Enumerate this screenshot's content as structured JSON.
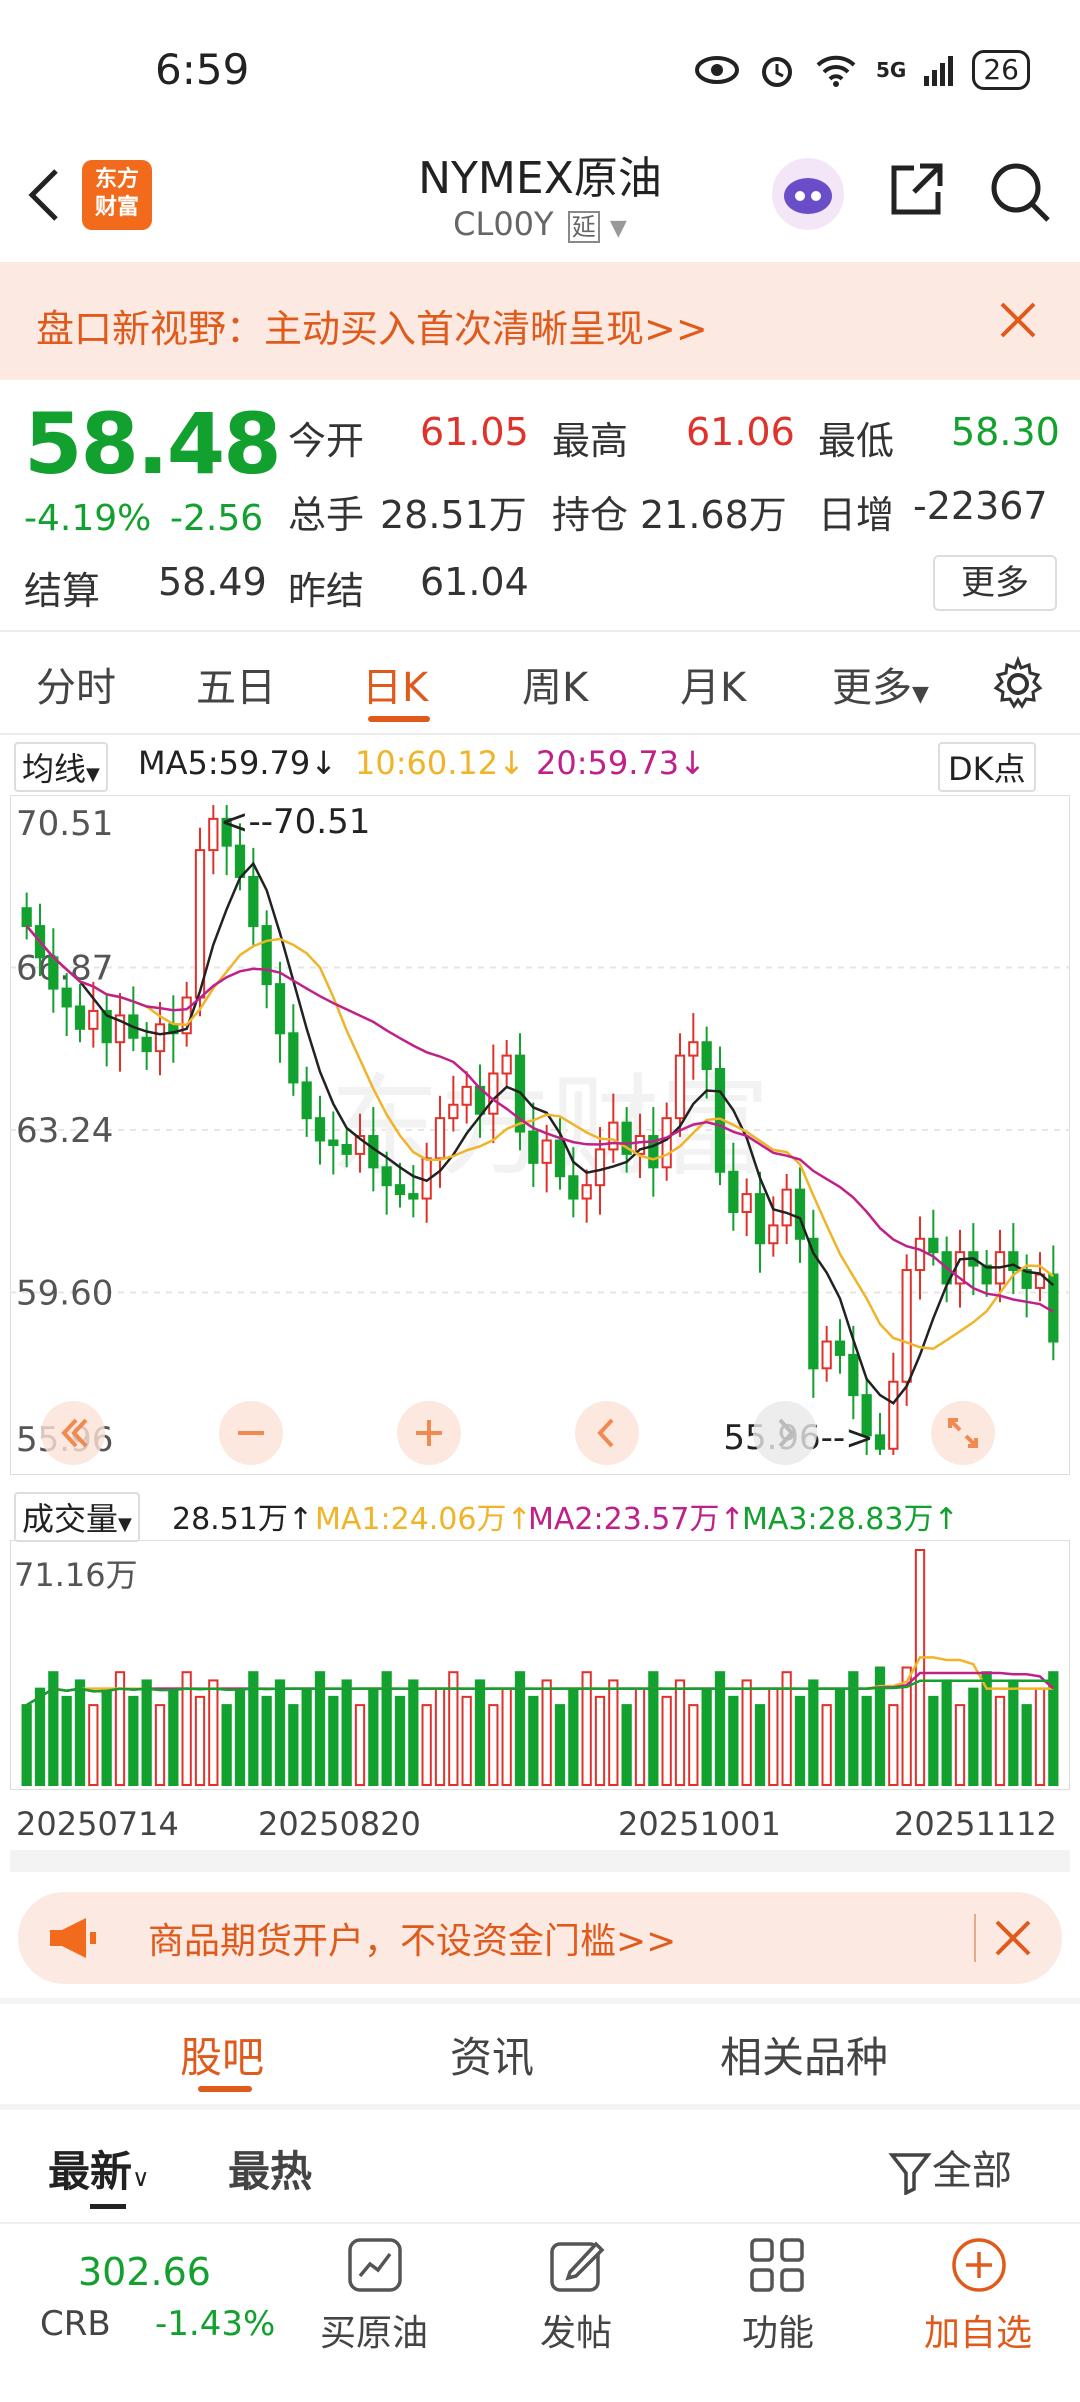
{
  "status_bar": {
    "time": "6:59",
    "signal": "5G",
    "battery": "26"
  },
  "header": {
    "logo_line1": "东方",
    "logo_line2": "财富",
    "title": "NYMEX原油",
    "subtitle": "CL00Y",
    "delay_badge": "延"
  },
  "promo": {
    "text": "盘口新视野：主动买入首次清晰呈现>>"
  },
  "quote": {
    "price": "58.48",
    "change_pct": "-4.19%",
    "change": "-2.56",
    "open_label": "今开",
    "open": "61.05",
    "high_label": "最高",
    "high": "61.06",
    "low_label": "最低",
    "low": "58.30",
    "volume_label": "总手",
    "volume": "28.51万",
    "position_label": "持仓",
    "position": "21.68万",
    "daily_inc_label": "日增",
    "daily_inc": "-22367",
    "settle_label": "结算",
    "settle": "58.49",
    "prev_settle_label": "昨结",
    "prev_settle": "61.04",
    "more_button": "更多"
  },
  "tabs": [
    "分时",
    "五日",
    "日K",
    "周K",
    "月K",
    "更多"
  ],
  "active_tab": "日K",
  "ma_bar": {
    "selector": "均线",
    "ma5": "MA5:59.79",
    "ma10": "10:60.12",
    "ma20": "20:59.73",
    "dk": "DK点"
  },
  "colors": {
    "up": "#e0322b",
    "down": "#12a12e",
    "accent": "#e05a1c",
    "ma5": "#222222",
    "ma10": "#f0b429",
    "ma20": "#c0208a"
  },
  "chart_data": {
    "type": "candlestick",
    "price_axis_labels": [
      "70.51",
      "66.87",
      "63.24",
      "59.60",
      "55.96"
    ],
    "ylim": [
      55.96,
      70.51
    ],
    "annotations": {
      "max": "<--70.51",
      "min": "55.96-->"
    },
    "closes": [
      67.8,
      67.1,
      66.4,
      66.0,
      65.5,
      65.9,
      65.2,
      65.8,
      65.3,
      65.0,
      65.6,
      65.4,
      66.2,
      69.5,
      70.2,
      69.6,
      68.9,
      67.8,
      66.5,
      65.4,
      64.3,
      63.5,
      63.0,
      62.9,
      62.7,
      63.1,
      62.4,
      62.0,
      61.8,
      61.7,
      62.6,
      63.5,
      63.8,
      64.2,
      63.6,
      64.5,
      64.9,
      63.2,
      62.5,
      63.0,
      62.2,
      61.7,
      62.0,
      62.8,
      63.4,
      62.7,
      63.1,
      62.4,
      63.5,
      64.9,
      65.2,
      64.6,
      62.3,
      61.4,
      61.8,
      60.7,
      61.1,
      61.9,
      60.8,
      57.9,
      58.5,
      58.2,
      57.3,
      56.4,
      56.1,
      57.6,
      60.1,
      60.8,
      60.5,
      59.8,
      60.5,
      60.2,
      59.8,
      60.5,
      60.1,
      59.7,
      60.0,
      58.5
    ],
    "volume_axis_label": "71.16万",
    "date_labels": [
      "20250714",
      "20250820",
      "20251001",
      "20251112"
    ]
  },
  "volume_bar": {
    "selector": "成交量",
    "value": "28.51万",
    "ma1": "MA1:24.06万",
    "ma2": "MA2:23.57万",
    "ma3": "MA3:28.83万"
  },
  "banner": {
    "text": "商品期货开户，不设资金门槛>>"
  },
  "content_tabs": [
    "股吧",
    "资讯",
    "相关品种"
  ],
  "sort": {
    "latest": "最新",
    "hot": "最热",
    "filter": "全部"
  },
  "bottom_nav": {
    "crb_value": "302.66",
    "crb_label": "CRB",
    "crb_change": "-1.43%",
    "buy": "买原油",
    "post": "发帖",
    "function": "功能",
    "add": "加自选"
  }
}
